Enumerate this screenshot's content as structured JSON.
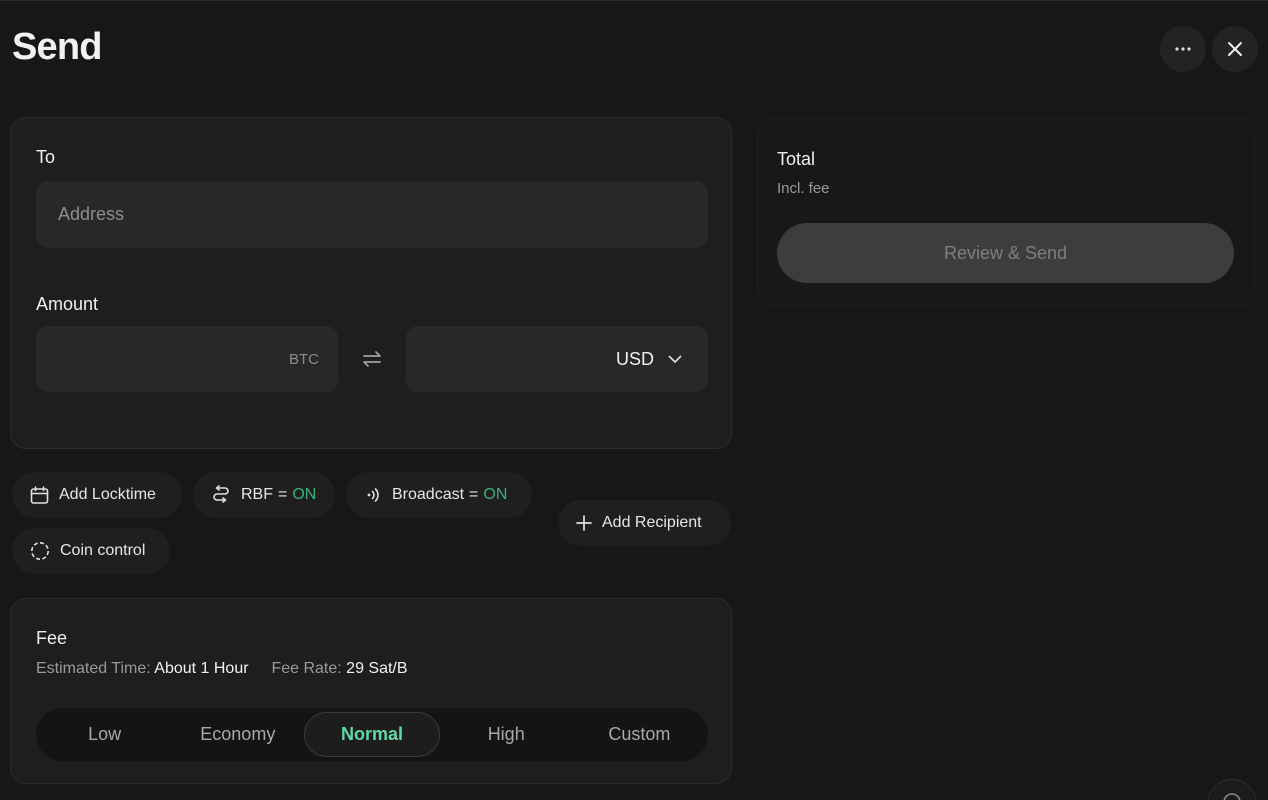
{
  "header": {
    "title": "Send"
  },
  "to_card": {
    "to_label": "To",
    "address_placeholder": "Address",
    "amount_label": "Amount",
    "btc_unit": "BTC",
    "fiat_currency": "USD"
  },
  "options": {
    "locktime_label": "Add Locktime",
    "rbf_label": "RBF",
    "rbf_eq": "=",
    "rbf_state": "ON",
    "broadcast_label": "Broadcast",
    "broadcast_eq": "=",
    "broadcast_state": "ON",
    "add_recipient_label": "Add Recipient",
    "coin_control_label": "Coin control"
  },
  "fee": {
    "title": "Fee",
    "estimated_time_key": "Estimated Time:",
    "estimated_time_value": "About 1 Hour",
    "fee_rate_key": "Fee Rate:",
    "fee_rate_value": "29 Sat/B",
    "levels": [
      "Low",
      "Economy",
      "Normal",
      "High",
      "Custom"
    ],
    "selected": "Normal"
  },
  "total": {
    "label": "Total",
    "sub_label": "Incl. fee",
    "review_button": "Review & Send"
  },
  "colors": {
    "background": "#171717",
    "card": "#1e1e1e",
    "accent_green": "#34b27b",
    "selected_fee_text": "#5fd9a6"
  },
  "icons": [
    "more-icon",
    "close-icon",
    "swap-icon",
    "chevron-down-icon",
    "calendar-icon",
    "rbf-icon",
    "broadcast-icon",
    "plus-icon",
    "coin-control-icon",
    "help-icon"
  ]
}
